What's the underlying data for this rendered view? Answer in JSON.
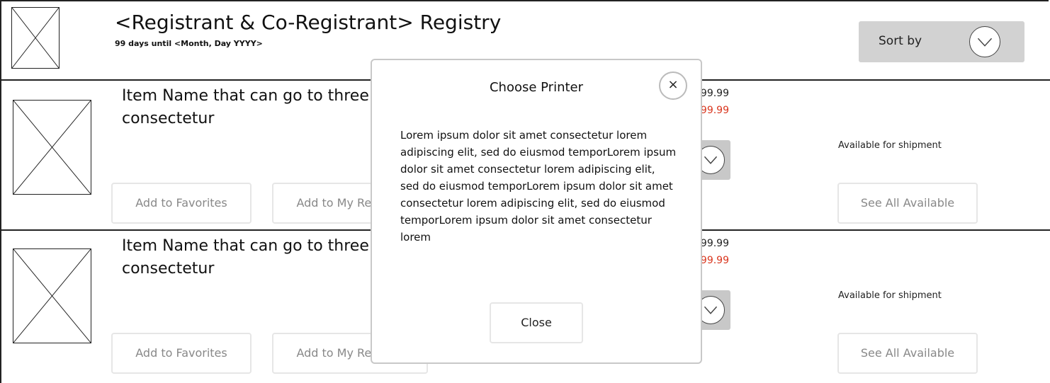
{
  "header": {
    "title": "<Registrant & Co-Registrant> Registry",
    "subtitle": "99 days until <Month, Day YYYY>",
    "sort_label": "Sort by"
  },
  "items": [
    {
      "name": "Item Name that can go to three lines lore ipsum dolor sit amet consectetur",
      "price_original": "$99.99",
      "price_sale": "$99.99",
      "availability": "Available for shipment",
      "add_favorites_label": "Add to Favorites",
      "add_registry_label": "Add to My Registry",
      "see_all_label": "See All Available"
    },
    {
      "name": "Item Name that can go to three lines lore ipsum dolor sit amet consectetur",
      "price_original": "$99.99",
      "price_sale": "$99.99",
      "availability": "Available for shipment",
      "add_favorites_label": "Add to Favorites",
      "add_registry_label": "Add to My Registry",
      "see_all_label": "See All Available"
    }
  ],
  "modal": {
    "title": "Choose Printer",
    "close_x": "×",
    "body": "Lorem ipsum dolor sit amet consectetur lorem adipiscing elit, sed do eiusmod temporLorem ipsum dolor sit amet consectetur lorem adipiscing elit, sed do eiusmod temporLorem ipsum dolor sit amet consectetur lorem adipiscing elit, sed do eiusmod temporLorem ipsum dolor sit amet consectetur lorem",
    "close_label": "Close"
  },
  "colors": {
    "sale_price": "#d9351d",
    "sort_bg": "#d2d2d2",
    "qty_bg": "#c8c8c8"
  }
}
